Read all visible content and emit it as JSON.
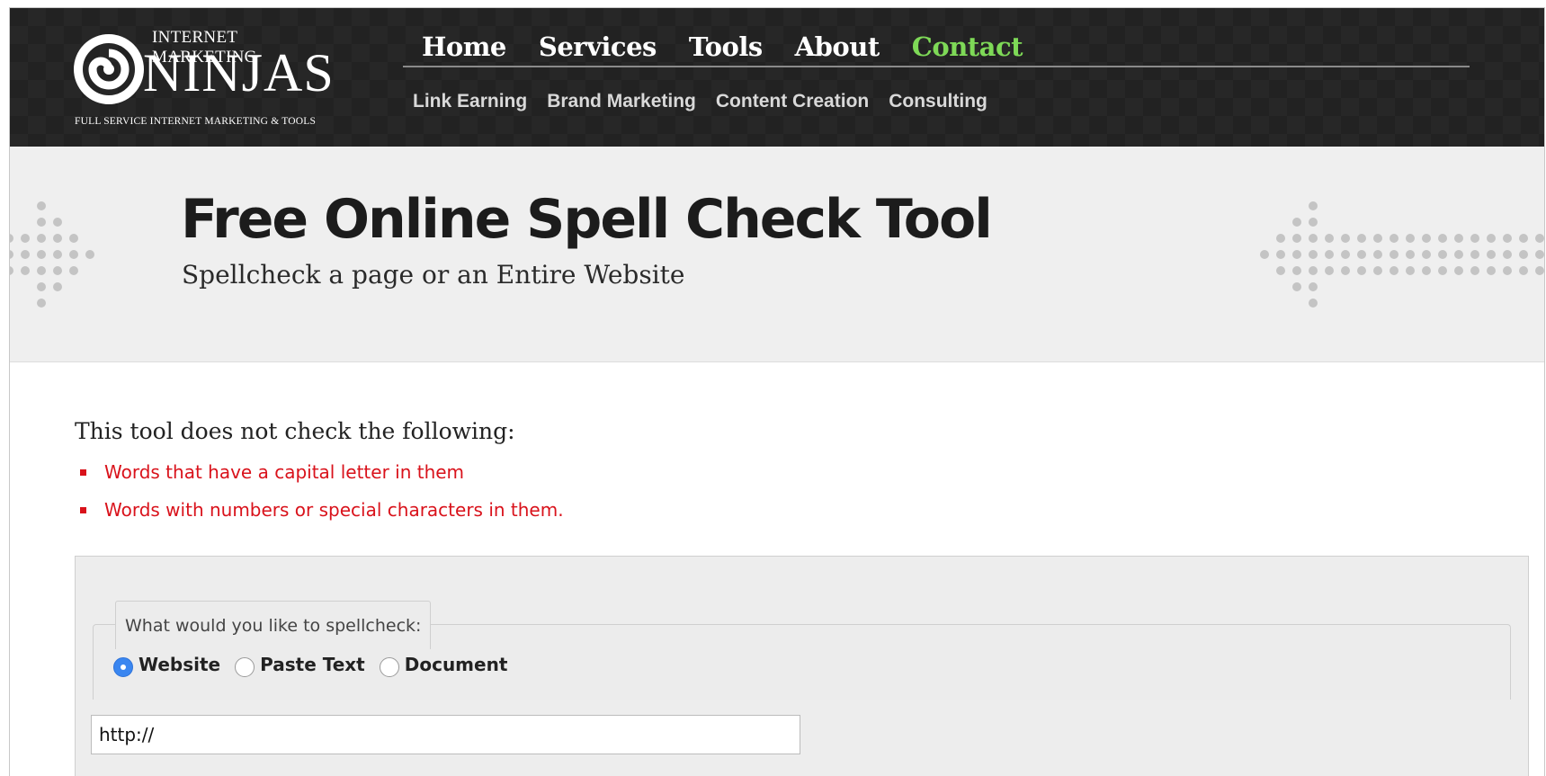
{
  "header": {
    "logo_top": "INTERNET MARKETING",
    "logo_main": "NINJAS",
    "logo_sub": "FULL SERVICE INTERNET MARKETING & TOOLS",
    "main_nav": [
      "Home",
      "Services",
      "Tools",
      "About",
      "Contact"
    ],
    "active_nav": "Contact",
    "sub_nav": [
      "Link Earning",
      "Brand Marketing",
      "Content Creation",
      "Consulting"
    ]
  },
  "hero": {
    "title": "Free Online Spell Check Tool",
    "subtitle": "Spellcheck a page or an Entire Website"
  },
  "notice": {
    "title": "This tool does not check the following:",
    "items": [
      "Words that have a capital letter in them",
      "Words with numbers or special characters in them."
    ]
  },
  "form": {
    "legend": "What would you like to spellcheck:",
    "options": [
      "Website",
      "Paste Text",
      "Document"
    ],
    "selected": "Website",
    "url_value": "http://"
  },
  "colors": {
    "header_bg": "#222222",
    "active_nav": "#7ed957",
    "notice_red": "#d9121b",
    "radio_checked": "#3a86f0"
  },
  "icons": {
    "logo": "swirl-logo-icon",
    "hero_left": "dotted-arrow-left-icon",
    "hero_right": "dotted-arrow-right-icon"
  }
}
